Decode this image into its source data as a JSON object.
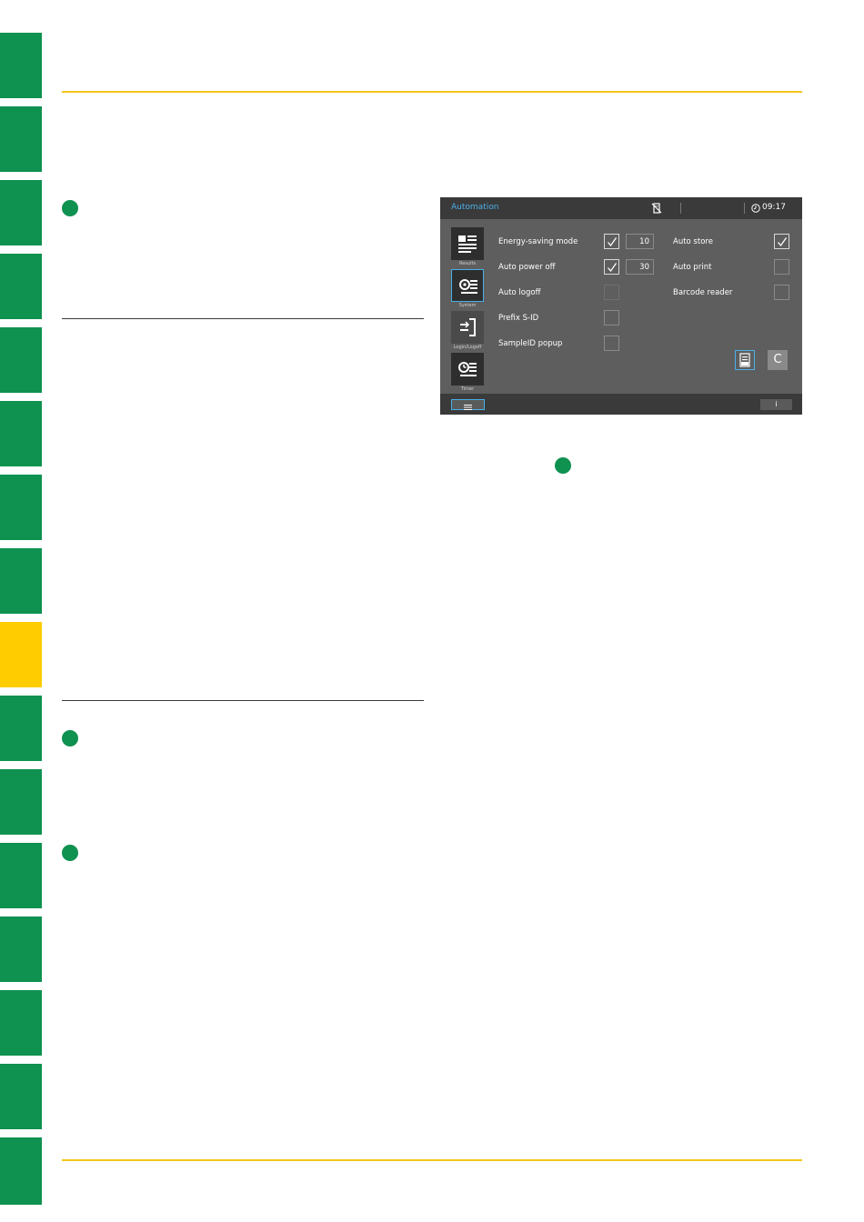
{
  "page": {
    "colors": {
      "accent_green": "#0f9150",
      "accent_yellow": "#ffcc00",
      "highlight_blue": "#4ab0e8"
    }
  },
  "screen": {
    "title": "Automation",
    "time": "09:17",
    "icons": {
      "status": "usb-disconnected-icon",
      "clock": "clock-icon"
    },
    "sidebar": [
      {
        "label": "Results",
        "icon": "results-icon",
        "active": false
      },
      {
        "label": "System",
        "icon": "system-icon",
        "active": true
      },
      {
        "label": "Login/Logoff",
        "icon": "login-logoff-icon",
        "active": false
      },
      {
        "label": "Timer",
        "icon": "timer-icon",
        "active": false
      }
    ],
    "left_options": [
      {
        "label": "Energy-saving mode",
        "checked": true,
        "value": "10"
      },
      {
        "label": "Auto power off",
        "checked": true,
        "value": "30"
      },
      {
        "label": "Auto logoff",
        "checked": false
      },
      {
        "label": "Prefix S-ID",
        "checked": false
      },
      {
        "label": "SampleID popup",
        "checked": false
      }
    ],
    "right_options": [
      {
        "label": "Auto store",
        "checked": true
      },
      {
        "label": "Auto print",
        "checked": false
      },
      {
        "label": "Barcode reader",
        "checked": false
      }
    ],
    "reset_symbol": "C",
    "info_symbol": "i"
  }
}
